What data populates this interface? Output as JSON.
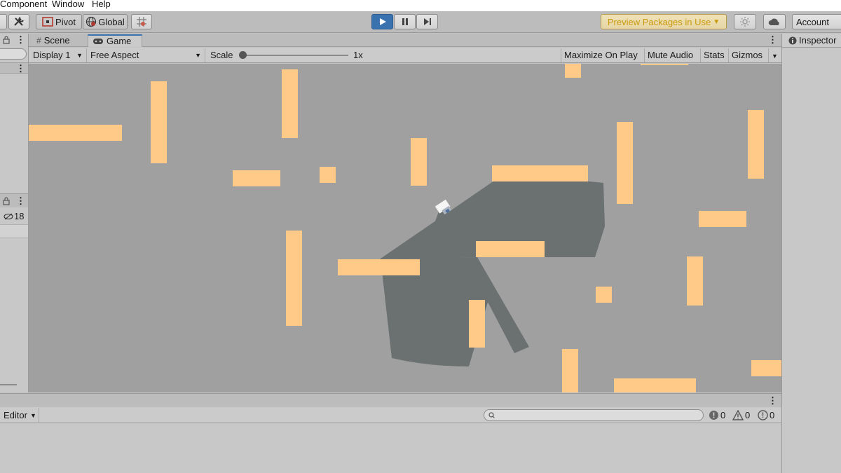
{
  "menu": [
    "Component",
    "Window",
    "Help"
  ],
  "toolbar": {
    "pivot_label": "Pivot",
    "global_label": "Global",
    "preview_label": "Preview Packages in Use",
    "account_label": "Account"
  },
  "tabs": [
    "Scene",
    "Game"
  ],
  "game_bar": {
    "display": "Display 1",
    "aspect": "Free Aspect",
    "scale_label": "Scale",
    "scale_value": "1x",
    "maximize": "Maximize On Play",
    "mute": "Mute Audio",
    "stats": "Stats",
    "gizmos": "Gizmos"
  },
  "left_panel": {
    "hidden_count": "18"
  },
  "inspector": {
    "title": "Inspector"
  },
  "console": {
    "editor_label": "Editor",
    "errors": "0",
    "warnings": "0",
    "messages": "0"
  },
  "colors": {
    "block": "#ffca87",
    "viewport": "#a0a0a0",
    "shadow": "#6b7070",
    "play_accent": "#3a72b0",
    "preview_text": "#c99a0a"
  }
}
